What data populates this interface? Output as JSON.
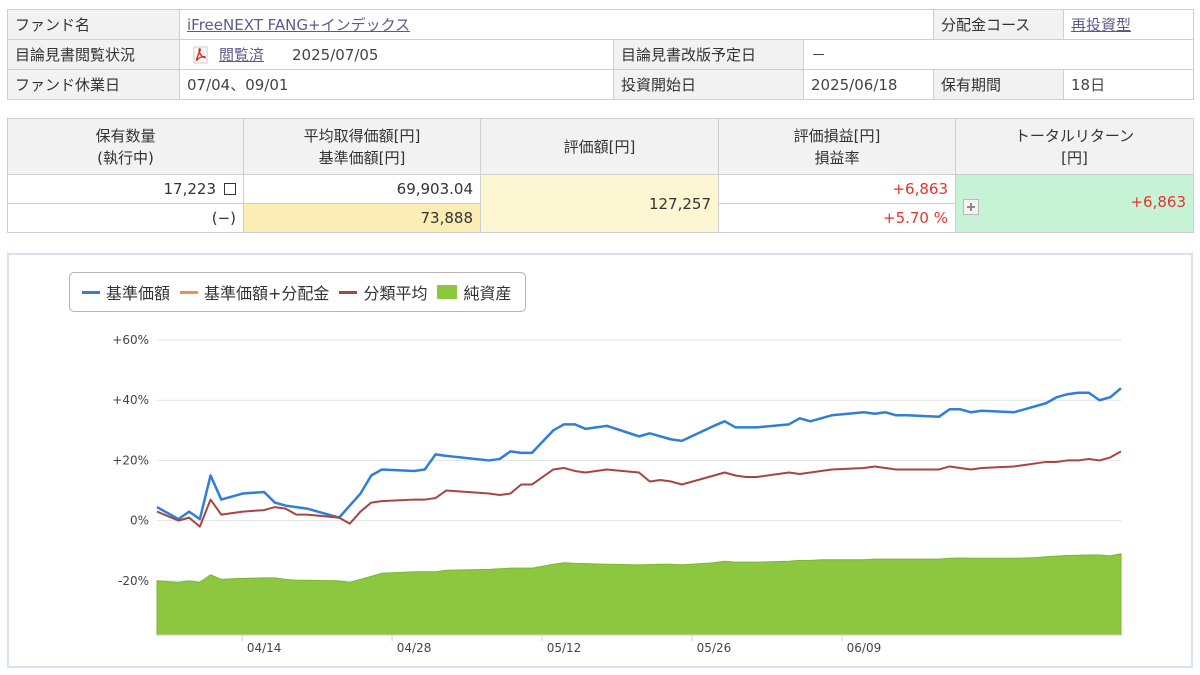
{
  "info": {
    "fund_name_label": "ファンド名",
    "fund_name": "iFreeNEXT FANG+インデックス",
    "dividend_course_label": "分配金コース",
    "dividend_course": "再投資型",
    "prospectus_status_label": "目論見書閲覧状況",
    "prospectus_status": "閲覧済",
    "prospectus_date": "2025/07/05",
    "prospectus_revision_label": "目論見書改版予定日",
    "prospectus_revision": "－",
    "holiday_label": "ファンド休業日",
    "holiday": "07/04、09/01",
    "start_label": "投資開始日",
    "start": "2025/06/18",
    "period_label": "保有期間",
    "period": "18日"
  },
  "holdings": {
    "headers": {
      "qty_1": "保有数量",
      "qty_2": "(執行中)",
      "avg_1": "平均取得価額[円]",
      "avg_2": "基準価額[円]",
      "eval": "評価額[円]",
      "pl_1": "評価損益[円]",
      "pl_2": "損益率",
      "tr_1": "トータルリターン",
      "tr_2": "[円]"
    },
    "quantity": "17,223",
    "pending": "(−)",
    "avg_price": "69,903.04",
    "nav": "73,888",
    "valuation": "127,257",
    "pl": "+6,863",
    "pl_rate": "+5.70 %",
    "total_return": "+6,863"
  },
  "chart_data": {
    "type": "line",
    "legend": [
      {
        "name": "基準価額",
        "color": "#2f7ed8"
      },
      {
        "name": "基準価額+分配金",
        "color": "#f28f43"
      },
      {
        "name": "分類平均",
        "color": "#a94442"
      },
      {
        "name": "純資産",
        "color": "#8dc63f"
      }
    ],
    "y_ticks": [
      "+60%",
      "+40%",
      "+20%",
      "0%",
      "-20%"
    ],
    "y_values": [
      60,
      40,
      20,
      0,
      -20
    ],
    "ylim": [
      -38,
      65
    ],
    "x_ticks": [
      "04/14",
      "04/28",
      "05/12",
      "05/26",
      "06/09"
    ],
    "x_tick_days": [
      11,
      25,
      39,
      53,
      67
    ],
    "x_range": [
      1,
      91
    ],
    "series": [
      {
        "name": "基準価額",
        "days": [
          1,
          3,
          4,
          5,
          6,
          7,
          8,
          9,
          11,
          12,
          13,
          14,
          15,
          18,
          19,
          20,
          21,
          22,
          25,
          26,
          27,
          28,
          32,
          33,
          34,
          35,
          36,
          38,
          39,
          40,
          41,
          42,
          43,
          46,
          47,
          48,
          49,
          50,
          53,
          54,
          55,
          56,
          57,
          60,
          61,
          62,
          63,
          64,
          67,
          68,
          69,
          70,
          71,
          74,
          75,
          76,
          77,
          78,
          81,
          82,
          83,
          84,
          85,
          86,
          87,
          88,
          89,
          90,
          91
        ],
        "values": [
          4.5,
          0.5,
          3,
          0.5,
          15,
          7,
          8,
          9,
          9.5,
          6,
          5,
          4.5,
          4,
          1,
          5,
          9,
          15,
          17,
          16.5,
          17,
          22,
          21.5,
          20,
          20.5,
          23,
          22.5,
          22.5,
          30,
          32,
          32,
          30.5,
          31,
          31.5,
          28,
          29,
          28,
          27,
          26.5,
          31.5,
          33,
          31,
          31,
          31,
          32,
          34,
          33,
          34,
          35,
          36,
          35.5,
          36,
          35,
          35,
          34.5,
          37,
          37,
          36,
          36.5,
          36,
          37,
          38,
          39,
          41,
          42,
          42.5,
          42.5,
          40,
          41,
          44
        ]
      },
      {
        "name": "分類平均",
        "days": [
          1,
          3,
          4,
          5,
          6,
          7,
          8,
          9,
          11,
          12,
          13,
          14,
          15,
          18,
          19,
          20,
          21,
          22,
          25,
          26,
          27,
          28,
          32,
          33,
          34,
          35,
          36,
          38,
          39,
          40,
          41,
          42,
          43,
          46,
          47,
          48,
          49,
          50,
          53,
          54,
          55,
          56,
          57,
          60,
          61,
          62,
          63,
          64,
          67,
          68,
          69,
          70,
          71,
          74,
          75,
          76,
          77,
          78,
          81,
          82,
          83,
          84,
          85,
          86,
          87,
          88,
          89,
          90,
          91
        ],
        "values": [
          3,
          0,
          1,
          -2,
          7,
          2,
          2.5,
          3,
          3.5,
          4.5,
          4,
          2,
          2,
          1,
          -1,
          3,
          6,
          6.5,
          7,
          7,
          7.5,
          10,
          9,
          8.5,
          9,
          12,
          12,
          17,
          17.5,
          16.5,
          16,
          16.5,
          17,
          16,
          13,
          13.5,
          13,
          12,
          15,
          16,
          15,
          14.5,
          14.5,
          16,
          15.5,
          16,
          16.5,
          17,
          17.5,
          18,
          17.5,
          17,
          17,
          17,
          18,
          17.5,
          17,
          17.5,
          18,
          18.5,
          19,
          19.5,
          19.5,
          20,
          20,
          20.5,
          20,
          21,
          23
        ]
      },
      {
        "name": "純資産",
        "days": [
          1,
          3,
          4,
          5,
          6,
          7,
          8,
          9,
          11,
          12,
          13,
          14,
          15,
          18,
          19,
          20,
          21,
          22,
          25,
          26,
          27,
          28,
          32,
          33,
          34,
          35,
          36,
          38,
          39,
          40,
          41,
          42,
          43,
          46,
          47,
          48,
          49,
          50,
          53,
          54,
          55,
          56,
          57,
          60,
          61,
          62,
          63,
          64,
          67,
          68,
          69,
          70,
          71,
          74,
          75,
          76,
          77,
          78,
          81,
          82,
          83,
          84,
          85,
          86,
          87,
          88,
          89,
          90,
          91
        ],
        "values": [
          -20,
          -20.5,
          -20,
          -20.5,
          -18,
          -19.5,
          -19.3,
          -19.2,
          -19,
          -19,
          -19.5,
          -19.8,
          -19.8,
          -20,
          -20.5,
          -19.5,
          -18.5,
          -17.5,
          -17,
          -17,
          -17,
          -16.5,
          -16.2,
          -16,
          -15.8,
          -15.8,
          -15.8,
          -14.5,
          -14,
          -14.2,
          -14.3,
          -14.4,
          -14.5,
          -14.7,
          -14.6,
          -14.5,
          -14.5,
          -14.7,
          -14,
          -13.5,
          -13.8,
          -13.8,
          -13.8,
          -13.5,
          -13.2,
          -13.2,
          -13,
          -13,
          -13,
          -12.8,
          -12.8,
          -12.8,
          -12.8,
          -12.8,
          -12.5,
          -12.4,
          -12.5,
          -12.5,
          -12.5,
          -12.4,
          -12.3,
          -12,
          -11.8,
          -11.6,
          -11.5,
          -11.4,
          -11.4,
          -11.7,
          -11
        ]
      }
    ]
  }
}
